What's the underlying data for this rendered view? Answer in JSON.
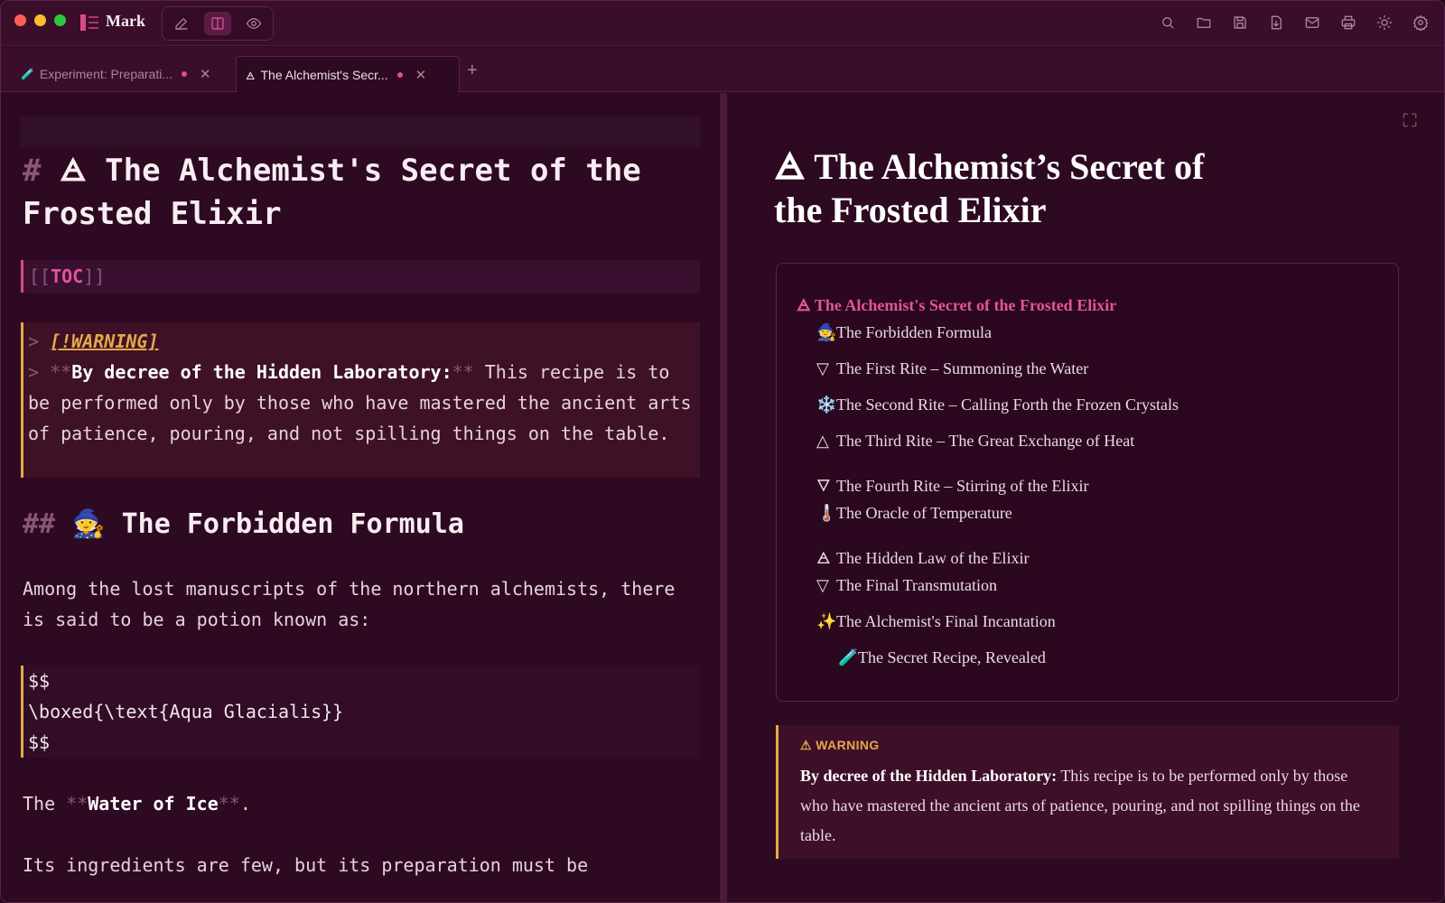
{
  "app": {
    "name": "Mark"
  },
  "tabs": [
    {
      "label": "Experiment: Preparati...",
      "icon": "test-tube-icon",
      "modified": true,
      "active": false
    },
    {
      "label": "The Alchemist's Secr...",
      "icon": "alchemy-triangle-icon",
      "modified": true,
      "active": true
    }
  ],
  "toolbar": {
    "icons": [
      "search-icon",
      "folder-icon",
      "save-icon",
      "export-icon",
      "mail-icon",
      "print-icon",
      "theme-icon",
      "settings-icon"
    ]
  },
  "editor": {
    "h1_hash": "#",
    "h1_text": "🜁 The Alchemist's Secret of the Frosted Elixir",
    "toc_open": "[[",
    "toc_word": "TOC",
    "toc_close": "]]",
    "warning_prefix": ">",
    "warning_tag": "[!WARNING]",
    "warning_line2_stars_open": "**",
    "warning_bold": "By decree of the Hidden Laboratory:",
    "warning_line2_stars_close": "**",
    "warning_rest": " This recipe is to be performed only by those who have mastered the ancient arts of patience, pouring, and not spilling things on the table.",
    "h2_hash": "##",
    "h2_text": "🧙 The Forbidden Formula",
    "para1": "Among the lost manuscripts of the northern alchemists, there is said to be a potion known as:",
    "math_open": "$$",
    "math_body": "\\boxed{\\text{Aqua Glacialis}}",
    "math_close": "$$",
    "para2_pre": "The ",
    "para2_stars": "**",
    "para2_bold": "Water of Ice",
    "para2_post": ".",
    "para3": "Its ingredients are few, but its preparation must be"
  },
  "preview": {
    "title": "🜁 The Alchemist’s Secret of the Frosted Elixir",
    "toc_title": "🜁 The Alchemist's Secret of the Frosted Elixir",
    "toc": [
      {
        "emoji": "🧙",
        "label": "The Forbidden Formula",
        "level": 1
      },
      {
        "emoji": "▽",
        "label": "The First Rite – Summoning the Water",
        "level": 1
      },
      {
        "emoji": "❄️",
        "label": "The Second Rite – Calling Forth the Frozen Crystals",
        "level": 1
      },
      {
        "emoji": "△",
        "label": "The Third Rite – The Great Exchange of Heat",
        "level": 1
      },
      {
        "emoji": "🜄",
        "label": "The Fourth Rite – Stirring of the Elixir",
        "level": 1
      },
      {
        "emoji": "🌡️",
        "label": "The Oracle of Temperature",
        "level": 1
      },
      {
        "emoji": "🜁",
        "label": "The Hidden Law of the Elixir",
        "level": 1
      },
      {
        "emoji": "▽",
        "label": "The Final Transmutation",
        "level": 1
      },
      {
        "emoji": "✨",
        "label": "The Alchemist's Final Incantation",
        "level": 1
      },
      {
        "emoji": "🧪",
        "label": "The Secret Recipe, Revealed",
        "level": 2
      }
    ],
    "warning_label": "⚠ WARNING",
    "warning_bold": "By decree of the Hidden Laboratory:",
    "warning_text": " This recipe is to be performed only by those who have mastered the ancient arts of patience, pouring, and not spilling things on the table."
  },
  "colors": {
    "accent": "#e2559a",
    "warning": "#e3a94a",
    "background": "#2e0a22"
  }
}
